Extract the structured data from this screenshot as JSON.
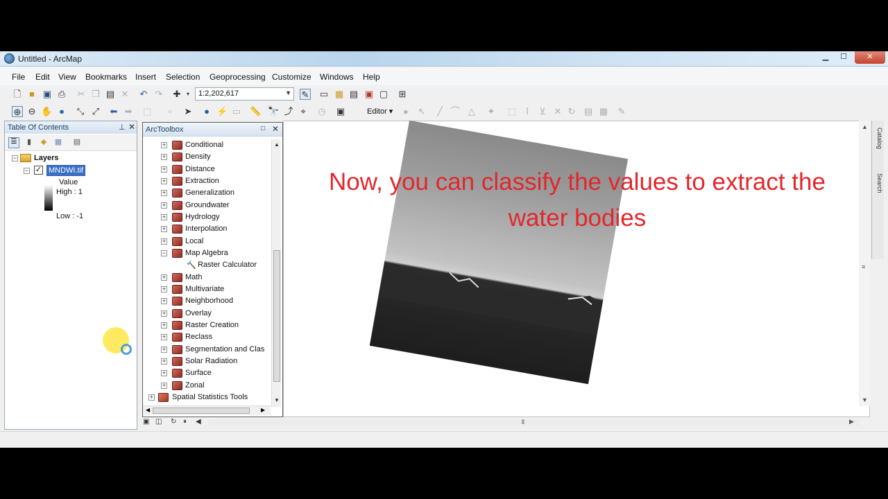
{
  "window": {
    "title": "Untitled - ArcMap"
  },
  "menu": [
    "File",
    "Edit",
    "View",
    "Bookmarks",
    "Insert",
    "Selection",
    "Geoprocessing",
    "Customize",
    "Windows",
    "Help"
  ],
  "toolbar": {
    "scale": "1:2,202,617",
    "editor_label": "Editor ▾"
  },
  "toc": {
    "title": "Table Of Contents",
    "root_label": "Layers",
    "layer_name": "MNDWI.tif",
    "legend": {
      "heading": "Value",
      "high": "High : 1",
      "low": "Low : -1"
    }
  },
  "toolbox": {
    "title": "ArcToolbox",
    "items": [
      "Conditional",
      "Density",
      "Distance",
      "Extraction",
      "Generalization",
      "Groundwater",
      "Hydrology",
      "Interpolation",
      "Local",
      "Map Algebra"
    ],
    "child_item": "Raster Calculator",
    "items_after": [
      "Math",
      "Multivariate",
      "Neighborhood",
      "Overlay",
      "Raster Creation",
      "Reclass",
      "Segmentation and Clas",
      "Solar Radiation",
      "Surface",
      "Zonal"
    ],
    "sibling_toolbox": "Spatial Statistics Tools"
  },
  "map": {
    "caption_line1": "Now, you can classify the values to extract the",
    "caption_line2": "water bodies",
    "caption_color": "#e3262b"
  },
  "side_tabs": [
    "Catalog",
    "Search"
  ]
}
